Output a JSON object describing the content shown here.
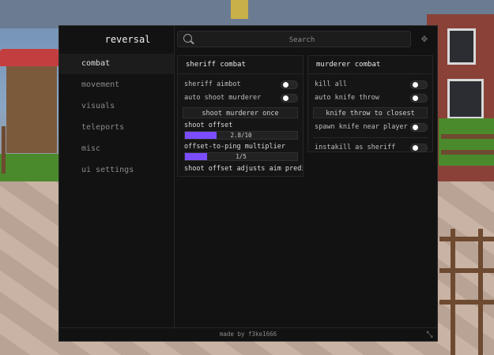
{
  "app": {
    "title": "reversal"
  },
  "sidebar": {
    "items": [
      {
        "label": "combat",
        "active": true
      },
      {
        "label": "movement"
      },
      {
        "label": "visuals"
      },
      {
        "label": "teleports"
      },
      {
        "label": "misc"
      },
      {
        "label": "ui settings"
      }
    ]
  },
  "search": {
    "placeholder": "Search",
    "value": ""
  },
  "sheriff": {
    "title": "sheriff combat",
    "aimbot_label": "sheriff aimbot",
    "aimbot_on": false,
    "auto_shoot_label": "auto shoot murderer",
    "auto_shoot_on": false,
    "shoot_once_label": "shoot murderer once",
    "offset_label": "shoot offset",
    "offset_value": "2.8/10",
    "offset_fraction": 0.28,
    "ping_label": "offset-to-ping multiplier",
    "ping_value": "1/5",
    "ping_fraction": 0.2,
    "note": "shoot offset adjusts aim predicti"
  },
  "murderer": {
    "title": "murderer combat",
    "kill_all_label": "kill all",
    "kill_all_on": false,
    "auto_knife_label": "auto knife throw",
    "auto_knife_on": false,
    "knife_closest_label": "knife throw to closest",
    "spawn_knife_label": "spawn knife near player",
    "spawn_knife_on": false,
    "instakill_label": "instakill as sheriff",
    "instakill_on": false
  },
  "footer": {
    "credit": "made by f3ke1666"
  },
  "colors": {
    "accent": "#7c4dff",
    "window_bg": "#121212",
    "panel_bg": "#151515"
  }
}
